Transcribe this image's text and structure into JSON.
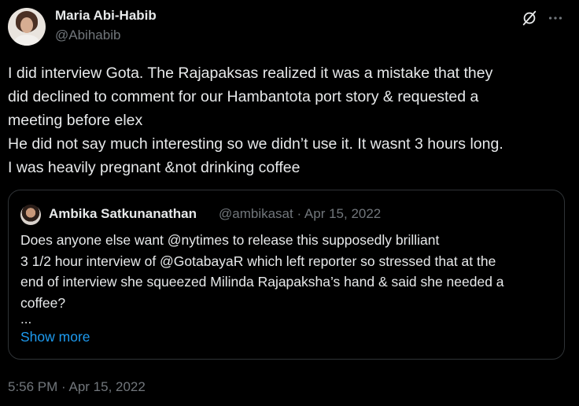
{
  "author": {
    "name": "Maria Abi-Habib",
    "handle": "@Abihabib"
  },
  "tweet": {
    "text": "I did interview Gota. The Rajapaksas realized it was a mistake that they\ndid declined to comment for our Hambantota port story & requested a\nmeeting before elex\nHe did not say much interesting so we didn’t use it. It wasnt 3 hours long.\nI was heavily pregnant &not drinking coffee",
    "timestamp": "5:56 PM · Apr 15, 2022"
  },
  "quoted": {
    "name": "Ambika Satkunanathan",
    "meta": "@ambikasat · Apr 15, 2022",
    "text": "Does anyone else want @nytimes to release this supposedly brilliant\n3 1/2 hour interview of @GotabayaR which left reporter so stressed that at the\nend of interview she squeezed Milinda Rajapaksha’s hand & said she needed a\ncoffee?",
    "ellipsis": "...",
    "show_more": "Show more"
  },
  "icons": {
    "grok": "grok-icon",
    "more": "more-dots-icon"
  },
  "colors": {
    "background": "#000000",
    "text": "#e7e9ea",
    "muted": "#71767b",
    "link": "#1d9bf0",
    "border": "#2f3336"
  }
}
